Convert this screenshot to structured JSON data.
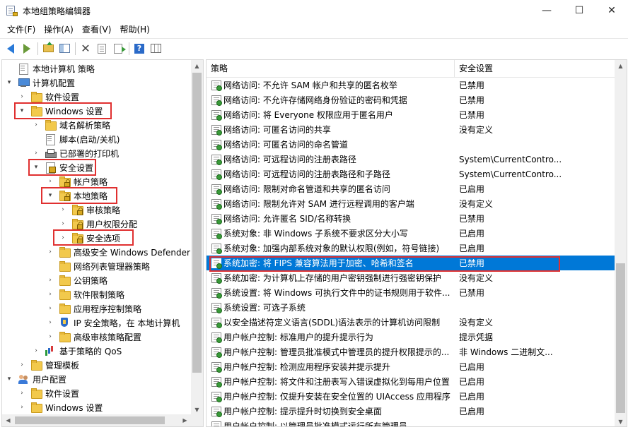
{
  "window": {
    "title": "本地组策略编辑器",
    "minimize_glyph": "—",
    "maximize_glyph": "☐",
    "close_glyph": "✕"
  },
  "menu": [
    "文件(F)",
    "操作(A)",
    "查看(V)",
    "帮助(H)"
  ],
  "toolbar": {
    "icons": [
      "back-arrow-icon",
      "forward-arrow-icon",
      "up-folder-icon",
      "show-hide-tree-icon",
      "delete-icon",
      "properties-icon",
      "export-list-icon",
      "help-icon",
      "extended-view-icon"
    ],
    "help_glyph": "?"
  },
  "tree": {
    "items": [
      {
        "label": "本地计算机 策略",
        "icon": "policy-doc-icon",
        "expander": ""
      },
      {
        "label": "计算机配置",
        "icon": "computer-icon",
        "expander": "▾"
      },
      {
        "label": "软件设置",
        "icon": "folder-icon",
        "expander": "›"
      },
      {
        "label": "Windows 设置",
        "icon": "folder-icon",
        "expander": "▾"
      },
      {
        "label": "域名解析策略",
        "icon": "folder-icon",
        "expander": "›"
      },
      {
        "label": "脚本(启动/关机)",
        "icon": "script-doc-icon",
        "expander": ""
      },
      {
        "label": "已部署的打印机",
        "icon": "printer-icon",
        "expander": "›"
      },
      {
        "label": "安全设置",
        "icon": "security-settings-icon",
        "expander": "▾"
      },
      {
        "label": "帐户策略",
        "icon": "locked-folder-icon",
        "expander": "›"
      },
      {
        "label": "本地策略",
        "icon": "locked-folder-icon",
        "expander": "▾"
      },
      {
        "label": "审核策略",
        "icon": "locked-folder-icon",
        "expander": "›"
      },
      {
        "label": "用户权限分配",
        "icon": "locked-folder-icon",
        "expander": "›"
      },
      {
        "label": "安全选项",
        "icon": "locked-folder-icon",
        "expander": "›"
      },
      {
        "label": "高级安全 Windows Defender",
        "icon": "folder-icon",
        "expander": "›"
      },
      {
        "label": "网络列表管理器策略",
        "icon": "folder-icon",
        "expander": ""
      },
      {
        "label": "公钥策略",
        "icon": "folder-icon",
        "expander": "›"
      },
      {
        "label": "软件限制策略",
        "icon": "folder-icon",
        "expander": "›"
      },
      {
        "label": "应用程序控制策略",
        "icon": "folder-icon",
        "expander": "›"
      },
      {
        "label": "IP 安全策略，在 本地计算机",
        "icon": "ip-security-icon",
        "expander": "›"
      },
      {
        "label": "高级审核策略配置",
        "icon": "folder-icon",
        "expander": "›"
      },
      {
        "label": "基于策略的 QoS",
        "icon": "qos-chart-icon",
        "expander": "›"
      },
      {
        "label": "管理模板",
        "icon": "folder-icon",
        "expander": "›"
      },
      {
        "label": "用户配置",
        "icon": "user-config-icon",
        "expander": "▾"
      },
      {
        "label": "软件设置",
        "icon": "folder-icon",
        "expander": "›"
      },
      {
        "label": "Windows 设置",
        "icon": "folder-icon",
        "expander": "›"
      }
    ]
  },
  "list": {
    "headers": {
      "policy": "策略",
      "setting": "安全设置"
    },
    "rows": [
      {
        "policy": "网络访问: 不允许 SAM 帐户和共享的匿名枚举",
        "setting": "已禁用"
      },
      {
        "policy": "网络访问: 不允许存储网络身份验证的密码和凭据",
        "setting": "已禁用"
      },
      {
        "policy": "网络访问: 将 Everyone 权限应用于匿名用户",
        "setting": "已禁用"
      },
      {
        "policy": "网络访问: 可匿名访问的共享",
        "setting": "没有定义"
      },
      {
        "policy": "网络访问: 可匿名访问的命名管道",
        "setting": ""
      },
      {
        "policy": "网络访问: 可远程访问的注册表路径",
        "setting": "System\\CurrentContro..."
      },
      {
        "policy": "网络访问: 可远程访问的注册表路径和子路径",
        "setting": "System\\CurrentContro..."
      },
      {
        "policy": "网络访问: 限制对命名管道和共享的匿名访问",
        "setting": "已启用"
      },
      {
        "policy": "网络访问: 限制允许对 SAM 进行远程调用的客户端",
        "setting": "没有定义"
      },
      {
        "policy": "网络访问: 允许匿名 SID/名称转换",
        "setting": "已禁用"
      },
      {
        "policy": "系统对象: 非 Windows 子系统不要求区分大小写",
        "setting": "已启用"
      },
      {
        "policy": "系统对象: 加强内部系统对象的默认权限(例如，符号链接)",
        "setting": "已启用"
      },
      {
        "policy": "系统加密: 将 FIPS 兼容算法用于加密、哈希和签名",
        "setting": "已禁用"
      },
      {
        "policy": "系统加密: 为计算机上存储的用户密钥强制进行强密钥保护",
        "setting": "没有定义"
      },
      {
        "policy": "系统设置: 将 Windows 可执行文件中的证书规则用于软件...",
        "setting": "已禁用"
      },
      {
        "policy": "系统设置: 可选子系统",
        "setting": ""
      },
      {
        "policy": "以安全描述符定义语言(SDDL)语法表示的计算机访问限制",
        "setting": "没有定义"
      },
      {
        "policy": "用户帐户控制: 标准用户的提升提示行为",
        "setting": "提示凭据"
      },
      {
        "policy": "用户帐户控制: 管理员批准模式中管理员的提升权限提示的...",
        "setting": "非 Windows 二进制文..."
      },
      {
        "policy": "用户帐户控制: 检测应用程序安装并提示提升",
        "setting": "已启用"
      },
      {
        "policy": "用户帐户控制: 将文件和注册表写入错误虚拟化到每用户位置",
        "setting": "已启用"
      },
      {
        "policy": "用户帐户控制: 仅提升安装在安全位置的 UIAccess 应用程序",
        "setting": "已启用"
      },
      {
        "policy": "用户帐户控制: 提示提升时切换到安全桌面",
        "setting": "已启用"
      },
      {
        "policy": "用户帐户控制: 以管理员批准模式运行所有管理员",
        "setting": ""
      }
    ],
    "selected_index": 12
  },
  "colors": {
    "selection": "#0078d7",
    "highlight_box": "#e03030"
  }
}
